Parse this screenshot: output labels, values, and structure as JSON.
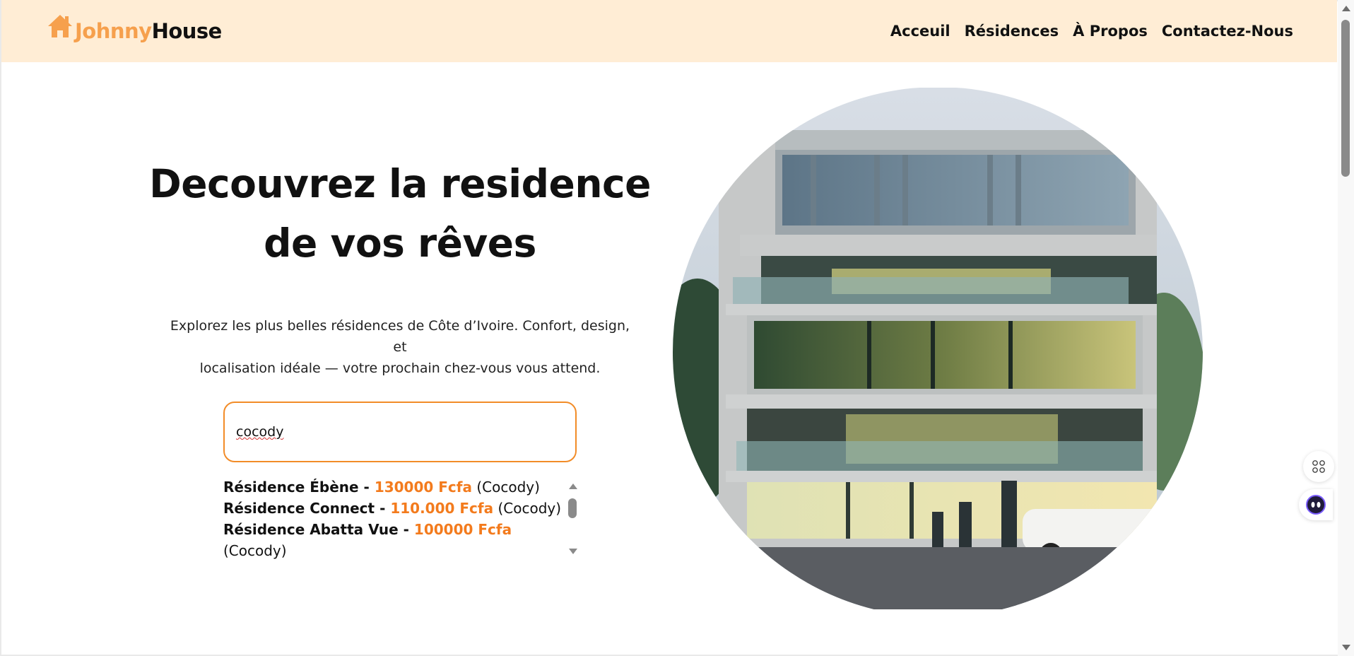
{
  "brand": {
    "name_part1": "Johnny",
    "name_part2": "House",
    "accent_color": "#f6a04d",
    "icon": "house-icon"
  },
  "nav": {
    "items": [
      {
        "label": "Acceuil"
      },
      {
        "label": "Résidences"
      },
      {
        "label": "À Propos"
      },
      {
        "label": "Contactez-Nous"
      }
    ]
  },
  "hero": {
    "title_line1": "Decouvrez la residence",
    "title_line2": "de vos rêves",
    "subtitle_line1": "Explorez les plus belles résidences de Côte d’Ivoire. Confort, design, et",
    "subtitle_line2": "localisation idéale — votre prochain chez-vous vous attend."
  },
  "search": {
    "value": "cocody",
    "border_color": "#f28c28"
  },
  "results": {
    "price_color": "#f37b1d",
    "items": [
      {
        "name": "Résidence Ébène - ",
        "price": "130000 Fcfa",
        "location": " (Cocody)"
      },
      {
        "name": "Résidence Connect - ",
        "price": "110.000 Fcfa",
        "location": " (Cocody)"
      },
      {
        "name": "Résidence Abatta Vue - ",
        "price": "100000 Fcfa",
        "location": " (Cocody)"
      }
    ]
  },
  "widgets": {
    "icons": [
      "apps-grid-icon",
      "assistant-face-icon"
    ]
  },
  "colors": {
    "navbar_bg": "#ffedd5"
  }
}
